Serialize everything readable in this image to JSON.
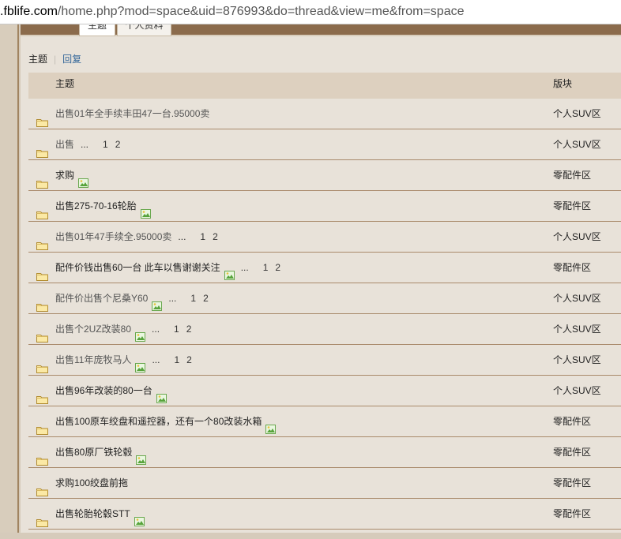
{
  "browser": {
    "url_host": ".fblife.com",
    "url_path": "/home.php?mod=space&uid=876993&do=thread&view=me&from=space"
  },
  "tabs": [
    {
      "label": "主题",
      "active": true
    },
    {
      "label": "个人资料",
      "active": false
    }
  ],
  "subnav": {
    "current": "主题",
    "sep": "|",
    "link": "回复"
  },
  "table": {
    "headers": {
      "topic": "主题",
      "forum": "版块"
    },
    "rows": [
      {
        "title": "出售01年全手续丰田47一台.95000卖",
        "visited": true,
        "has_image": false,
        "pages": [],
        "forum": "个人SUV区"
      },
      {
        "title": "出售",
        "visited": true,
        "has_image": false,
        "pages": [
          "1",
          "2"
        ],
        "forum": "个人SUV区"
      },
      {
        "title": "求购",
        "visited": false,
        "has_image": true,
        "pages": [],
        "forum": "零配件区"
      },
      {
        "title": "出售275-70-16轮胎",
        "visited": false,
        "has_image": true,
        "pages": [],
        "forum": "零配件区"
      },
      {
        "title": "出售01年47手续全.95000卖",
        "visited": true,
        "has_image": false,
        "pages": [
          "1",
          "2"
        ],
        "forum": "个人SUV区"
      },
      {
        "title": "配件价钱出售60一台 此车以售谢谢关注",
        "visited": false,
        "has_image": true,
        "pages": [
          "1",
          "2"
        ],
        "forum": "零配件区"
      },
      {
        "title": "配件价出售个尼桑Y60",
        "visited": true,
        "has_image": true,
        "pages": [
          "1",
          "2"
        ],
        "forum": "个人SUV区"
      },
      {
        "title": "出售个2UZ改装80",
        "visited": true,
        "has_image": true,
        "pages": [
          "1",
          "2"
        ],
        "forum": "个人SUV区"
      },
      {
        "title": "出售11年庞牧马人",
        "visited": true,
        "has_image": true,
        "pages": [
          "1",
          "2"
        ],
        "forum": "个人SUV区"
      },
      {
        "title": "出售96年改装的80一台",
        "visited": false,
        "has_image": true,
        "pages": [],
        "forum": "个人SUV区"
      },
      {
        "title": "出售100原车绞盘和遥控器，还有一个80改装水箱",
        "visited": false,
        "has_image": true,
        "pages": [],
        "forum": "零配件区"
      },
      {
        "title": "出售80原厂铁轮毂",
        "visited": false,
        "has_image": true,
        "pages": [],
        "forum": "零配件区"
      },
      {
        "title": "求购100绞盘前拖",
        "visited": false,
        "has_image": false,
        "pages": [],
        "forum": "零配件区"
      },
      {
        "title": "出售轮胎轮毂STT",
        "visited": false,
        "has_image": true,
        "pages": [],
        "forum": "零配件区"
      }
    ],
    "page_dots": "..."
  },
  "icons": {
    "folder": "folder-icon",
    "image": "image-attachment-icon"
  },
  "colors": {
    "header_bg": "#ddd0bf",
    "row_border": "#a98a6b",
    "link": "#336699",
    "tabbar": "#8b6b4c"
  }
}
